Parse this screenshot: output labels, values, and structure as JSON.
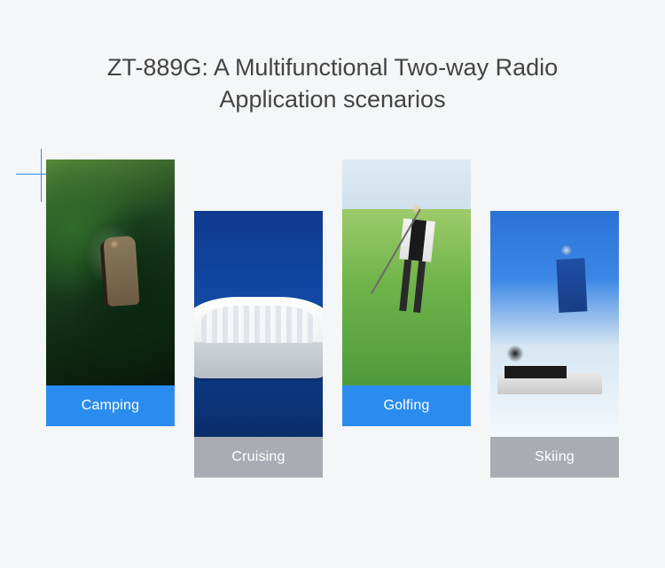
{
  "heading_line1": "ZT-889G: A Multifunctional Two-way Radio",
  "heading_line2": "Application scenarios",
  "colors": {
    "blue": "#2b8cf0",
    "gray": "#a9adb3"
  },
  "scenarios": [
    {
      "label": "Camping",
      "captionStyle": "blue",
      "image": "camping"
    },
    {
      "label": "Cruising",
      "captionStyle": "gray",
      "image": "cruising"
    },
    {
      "label": "Golfing",
      "captionStyle": "blue",
      "image": "golfing"
    },
    {
      "label": "Skiing",
      "captionStyle": "gray",
      "image": "skiing"
    }
  ]
}
